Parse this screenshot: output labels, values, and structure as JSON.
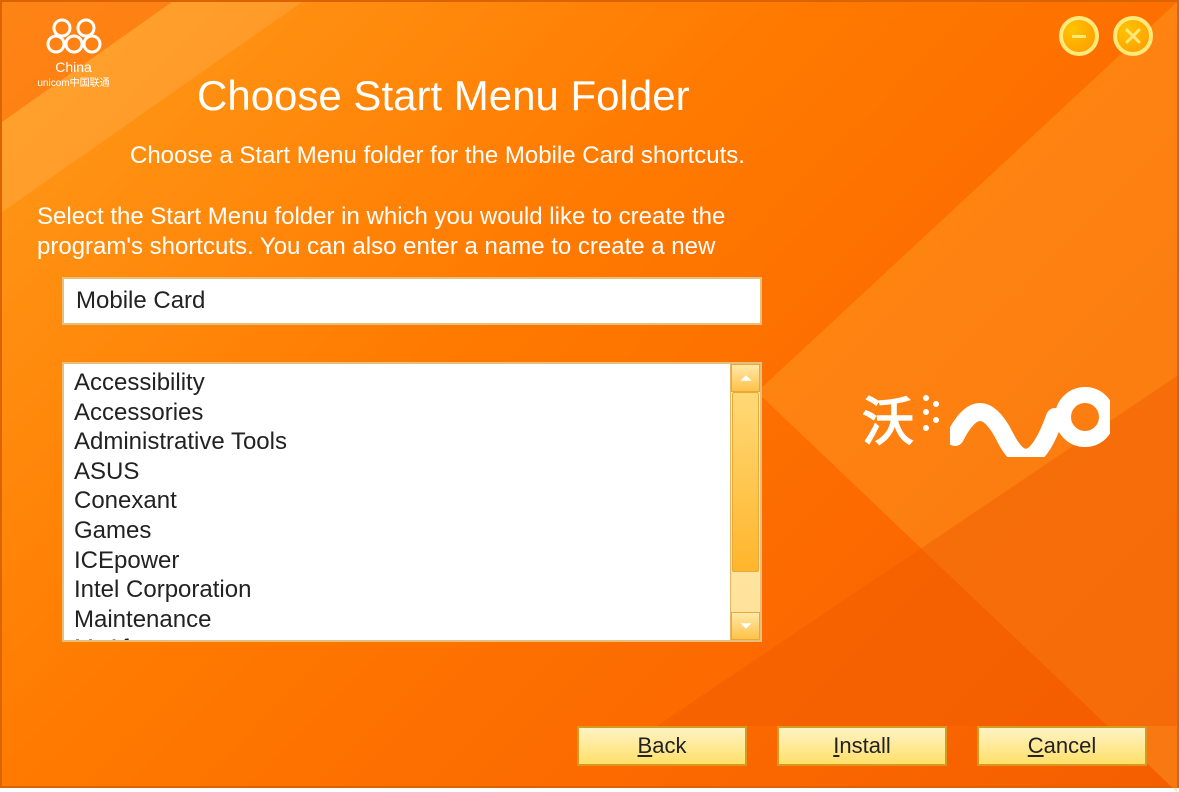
{
  "logo": {
    "line1": "China",
    "line2": "unicom中国联通"
  },
  "window_controls": {
    "minimize": "minimize",
    "close": "close"
  },
  "title": "Choose Start Menu Folder",
  "subtitle": "Choose a Start Menu folder for the Mobile Card shortcuts.",
  "instruction": "Select the Start Menu folder in which you would like to create the program's shortcuts. You can also enter a name to create a new",
  "folder_input": "Mobile Card",
  "folder_list": [
    "Accessibility",
    "Accessories",
    "Administrative Tools",
    "ASUS",
    "Conexant",
    "Games",
    "ICEpower",
    "Intel Corporation",
    "Maintenance",
    "McAfee"
  ],
  "wo": {
    "char": "沃"
  },
  "buttons": {
    "back": "Back",
    "install": "Install",
    "cancel": "Cancel"
  }
}
